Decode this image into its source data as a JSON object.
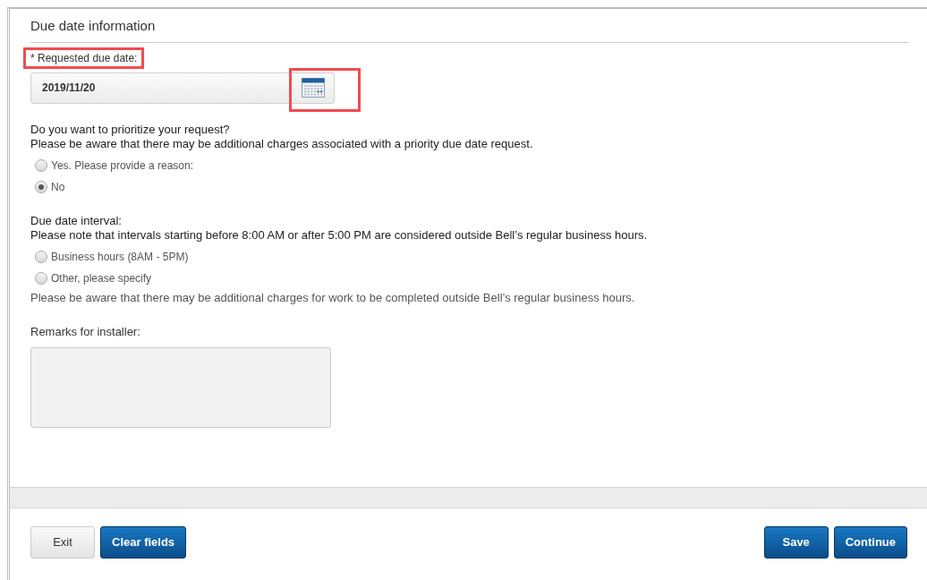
{
  "section": {
    "title": "Due date information"
  },
  "date_field": {
    "label": "* Requested due date:",
    "value": "2019/11/20",
    "label_highlighted": true,
    "calendar_highlighted": true
  },
  "priority": {
    "question": "Do you want to prioritize your request?",
    "note": "Please be aware that there may be additional charges associated with a priority due date request.",
    "options": [
      {
        "label": "Yes. Please provide a reason:",
        "selected": false
      },
      {
        "label": "No",
        "selected": true
      }
    ]
  },
  "interval": {
    "label": "Due date interval:",
    "note": "Please note that intervals starting before 8:00 AM or after 5:00 PM are considered outside Bell’s regular business hours.",
    "options": [
      {
        "label": "Business hours (8AM - 5PM)",
        "selected": false
      },
      {
        "label": "Other, please specify",
        "selected": false
      }
    ],
    "footer_note": "Please be aware that there may be additional charges for work to be completed outside Bell’s regular business hours."
  },
  "remarks": {
    "label": "Remarks for installer:"
  },
  "footer": {
    "left_buttons": [
      {
        "label": "Exit",
        "kind": "secondary"
      },
      {
        "label": "Clear fields",
        "kind": "primary"
      }
    ],
    "right_buttons": [
      {
        "label": "Save",
        "kind": "primary"
      },
      {
        "label": "Continue",
        "kind": "primary"
      }
    ]
  }
}
